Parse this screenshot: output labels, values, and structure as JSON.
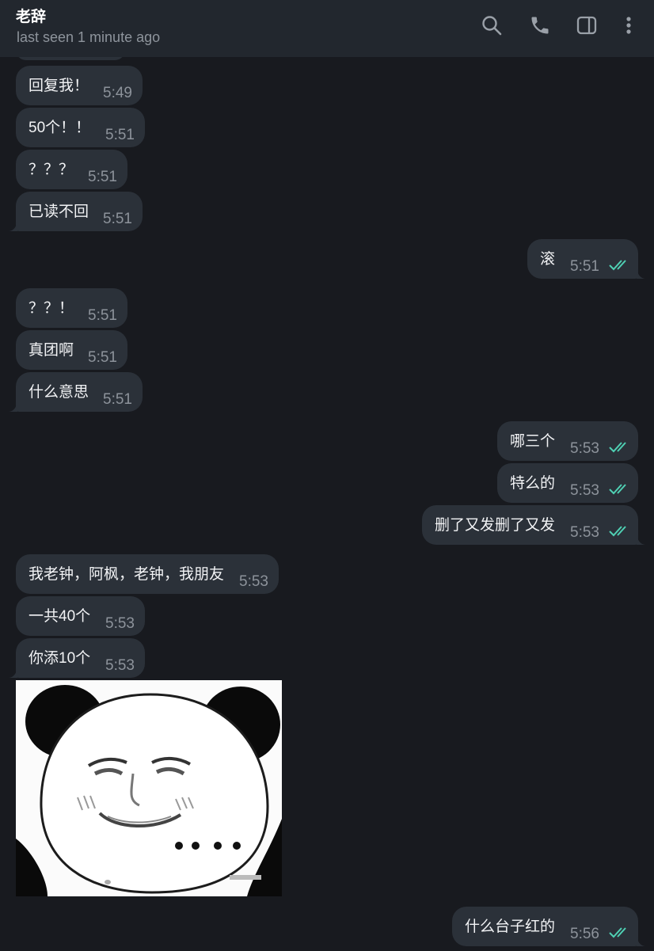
{
  "header": {
    "title": "老辞",
    "status": "last seen 1 minute ago",
    "icons": [
      "search-icon",
      "phone-icon",
      "side-panel-icon",
      "more-vertical-icon"
    ]
  },
  "colors": {
    "background": "#181a1f",
    "header": "#22272e",
    "bubble": "#2b3139",
    "time": "#8d939b",
    "read_check": "#4fd1b4"
  },
  "messages": [
    {
      "text": "回复我！",
      "time": "5:49",
      "direction": "incoming"
    },
    {
      "text": "50个！！",
      "time": "5:51",
      "direction": "incoming"
    },
    {
      "text": "？？？",
      "time": "5:51",
      "direction": "incoming"
    },
    {
      "text": "已读不回",
      "time": "5:51",
      "direction": "incoming"
    },
    {
      "text": "滚",
      "time": "5:51",
      "direction": "outgoing",
      "read": true
    },
    {
      "text": "？？！",
      "time": "5:51",
      "direction": "incoming"
    },
    {
      "text": "真团啊",
      "time": "5:51",
      "direction": "incoming"
    },
    {
      "text": "什么意思",
      "time": "5:51",
      "direction": "incoming"
    },
    {
      "text": "哪三个",
      "time": "5:53",
      "direction": "outgoing",
      "read": true
    },
    {
      "text": "特么的",
      "time": "5:53",
      "direction": "outgoing",
      "read": true
    },
    {
      "text": "删了又发删了又发",
      "time": "5:53",
      "direction": "outgoing",
      "read": true
    },
    {
      "text": "我老钟，阿枫，老钟，我朋友",
      "time": "5:53",
      "direction": "incoming"
    },
    {
      "text": "一共40个",
      "time": "5:53",
      "direction": "incoming"
    },
    {
      "text": "你添10个",
      "time": "5:53",
      "direction": "incoming"
    },
    {
      "text": "什么台子红的",
      "time": "5:56",
      "direction": "outgoing",
      "read": true
    }
  ],
  "sticker": {
    "kind": "panda-meme-sticker",
    "caption": "...."
  }
}
